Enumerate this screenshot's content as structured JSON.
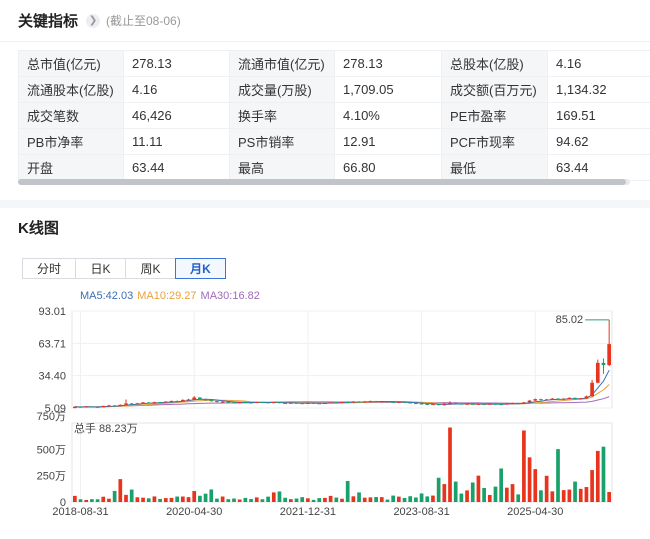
{
  "key_metrics": {
    "title": "关键指标",
    "date_note": "(截止至08-06)",
    "rows": [
      [
        {
          "label": "总市值(亿元)",
          "value": "278.13"
        },
        {
          "label": "流通市值(亿元)",
          "value": "278.13"
        },
        {
          "label": "总股本(亿股)",
          "value": "4.16"
        }
      ],
      [
        {
          "label": "流通股本(亿股)",
          "value": "4.16"
        },
        {
          "label": "成交量(万股)",
          "value": "1,709.05"
        },
        {
          "label": "成交额(百万元)",
          "value": "1,134.32"
        }
      ],
      [
        {
          "label": "成交笔数",
          "value": "46,426"
        },
        {
          "label": "换手率",
          "value": "4.10%"
        },
        {
          "label": "PE市盈率",
          "value": "169.51"
        }
      ],
      [
        {
          "label": "PB市净率",
          "value": "11.11"
        },
        {
          "label": "PS市销率",
          "value": "12.91"
        },
        {
          "label": "PCF市现率",
          "value": "94.62"
        }
      ],
      [
        {
          "label": "开盘",
          "value": "63.44"
        },
        {
          "label": "最高",
          "value": "66.80"
        },
        {
          "label": "最低",
          "value": "63.44"
        }
      ]
    ]
  },
  "kline": {
    "title": "K线图",
    "tabs": [
      "分时",
      "日K",
      "周K",
      "月K"
    ],
    "active_tab": 3,
    "ma": {
      "ma5": "MA5:42.03",
      "ma10": "MA10:29.27",
      "ma30": "MA30:16.82"
    },
    "colors": {
      "up": "#e8341c",
      "down": "#1aa06a",
      "ma5": "#3d6fb6",
      "ma10": "#e8a23b",
      "ma30": "#a06bb8"
    }
  },
  "chart_data": {
    "type": "candlestick",
    "price_ticks": [
      "93.01",
      "63.71",
      "34.40",
      "5.09"
    ],
    "price_range": [
      5.09,
      93.01
    ],
    "max_marker": "85.02",
    "volume_header": "750万",
    "volume_ticks": [
      "500万",
      "250万",
      "0"
    ],
    "volume_unit_max": 750,
    "volume_label": "总手 88.23万",
    "x_labels": [
      "2018-08-31",
      "2020-04-30",
      "2021-12-31",
      "2023-08-31",
      "2025-04-30"
    ],
    "x_label_index": [
      1,
      21,
      41,
      61,
      81
    ],
    "candles": [
      [
        5.0,
        6.2,
        4.9,
        6.5,
        0
      ],
      [
        6.2,
        5.8,
        5.5,
        6.6,
        1
      ],
      [
        5.8,
        6.4,
        5.6,
        6.7,
        0
      ],
      [
        6.4,
        6.1,
        5.9,
        6.6,
        1
      ],
      [
        6.1,
        5.9,
        5.6,
        6.4,
        1
      ],
      [
        5.9,
        7.0,
        5.8,
        7.2,
        0
      ],
      [
        7.0,
        7.4,
        6.8,
        8.0,
        0
      ],
      [
        7.4,
        7.2,
        6.9,
        7.8,
        1
      ],
      [
        7.2,
        8.0,
        7.0,
        8.3,
        0
      ],
      [
        8.0,
        9.2,
        7.8,
        12.8,
        0
      ],
      [
        9.2,
        8.6,
        8.3,
        9.5,
        1
      ],
      [
        8.6,
        9.4,
        8.5,
        9.8,
        0
      ],
      [
        9.4,
        10.1,
        9.2,
        10.5,
        0
      ],
      [
        10.1,
        9.6,
        9.3,
        10.4,
        1
      ],
      [
        9.6,
        10.4,
        9.5,
        10.8,
        0
      ],
      [
        10.4,
        10.0,
        9.7,
        10.7,
        1
      ],
      [
        10.0,
        10.9,
        9.8,
        11.2,
        0
      ],
      [
        10.9,
        11.5,
        10.7,
        11.8,
        0
      ],
      [
        11.5,
        11.2,
        10.9,
        11.9,
        1
      ],
      [
        11.2,
        12.4,
        11.0,
        13.0,
        0
      ],
      [
        12.4,
        12.8,
        12.1,
        13.4,
        0
      ],
      [
        12.8,
        14.6,
        12.5,
        15.8,
        0
      ],
      [
        14.6,
        13.2,
        12.8,
        14.9,
        1
      ],
      [
        13.2,
        12.1,
        11.7,
        13.5,
        1
      ],
      [
        12.1,
        11.4,
        11.0,
        12.3,
        1
      ],
      [
        11.4,
        10.6,
        10.2,
        11.6,
        1
      ],
      [
        10.6,
        10.9,
        10.3,
        11.2,
        0
      ],
      [
        10.9,
        10.2,
        9.9,
        11.1,
        1
      ],
      [
        10.2,
        9.8,
        9.5,
        10.4,
        1
      ],
      [
        9.8,
        10.4,
        9.6,
        10.7,
        0
      ],
      [
        10.4,
        10.1,
        9.8,
        10.6,
        1
      ],
      [
        10.1,
        9.7,
        9.4,
        10.3,
        1
      ],
      [
        9.7,
        10.5,
        9.6,
        10.8,
        0
      ],
      [
        10.5,
        10.2,
        9.9,
        10.8,
        1
      ],
      [
        10.2,
        9.9,
        9.6,
        10.4,
        1
      ],
      [
        9.9,
        10.4,
        9.7,
        10.7,
        0
      ],
      [
        10.4,
        9.6,
        9.3,
        10.6,
        1
      ],
      [
        9.6,
        9.2,
        8.9,
        9.8,
        1
      ],
      [
        9.2,
        9.8,
        9.0,
        10.0,
        0
      ],
      [
        9.8,
        9.5,
        9.2,
        10.0,
        1
      ],
      [
        9.5,
        9.3,
        9.0,
        9.8,
        1
      ],
      [
        9.3,
        9.7,
        9.1,
        10.2,
        0
      ],
      [
        9.7,
        9.4,
        9.1,
        9.9,
        1
      ],
      [
        9.4,
        9.1,
        8.8,
        9.6,
        1
      ],
      [
        9.1,
        9.6,
        8.9,
        9.8,
        0
      ],
      [
        9.6,
        10.1,
        9.4,
        10.4,
        0
      ],
      [
        10.1,
        9.8,
        9.5,
        10.3,
        1
      ],
      [
        9.8,
        10.5,
        9.6,
        10.8,
        0
      ],
      [
        10.5,
        10.2,
        9.9,
        11.2,
        1
      ],
      [
        10.2,
        11.0,
        10.0,
        11.4,
        0
      ],
      [
        11.0,
        10.5,
        10.2,
        11.3,
        1
      ],
      [
        10.5,
        10.9,
        10.3,
        11.5,
        0
      ],
      [
        10.9,
        11.3,
        10.6,
        11.8,
        0
      ],
      [
        11.3,
        10.8,
        10.5,
        11.6,
        1
      ],
      [
        10.8,
        11.2,
        10.5,
        11.5,
        0
      ],
      [
        11.2,
        10.7,
        10.4,
        11.4,
        1
      ],
      [
        10.7,
        10.3,
        10.0,
        10.9,
        1
      ],
      [
        10.3,
        10.6,
        10.0,
        10.9,
        0
      ],
      [
        10.6,
        10.1,
        9.8,
        10.8,
        1
      ],
      [
        10.1,
        9.6,
        9.2,
        10.3,
        1
      ],
      [
        9.6,
        9.2,
        8.6,
        9.8,
        1
      ],
      [
        9.2,
        8.8,
        8.3,
        9.4,
        1
      ],
      [
        8.8,
        8.2,
        7.6,
        9.0,
        1
      ],
      [
        8.2,
        8.6,
        8.0,
        8.9,
        0
      ],
      [
        8.6,
        7.9,
        7.4,
        8.8,
        1
      ],
      [
        7.9,
        8.4,
        7.6,
        10.2,
        0
      ],
      [
        8.4,
        9.6,
        8.1,
        11.2,
        0
      ],
      [
        9.6,
        9.0,
        8.7,
        9.9,
        1
      ],
      [
        9.0,
        8.6,
        8.3,
        9.3,
        1
      ],
      [
        8.6,
        8.9,
        8.4,
        9.2,
        0
      ],
      [
        8.9,
        8.5,
        8.2,
        9.1,
        1
      ],
      [
        8.5,
        8.8,
        8.3,
        9.1,
        0
      ],
      [
        8.8,
        8.4,
        8.1,
        9.0,
        1
      ],
      [
        8.4,
        8.9,
        8.2,
        9.2,
        0
      ],
      [
        8.9,
        8.6,
        8.3,
        9.1,
        1
      ],
      [
        8.6,
        8.3,
        8.0,
        8.8,
        1
      ],
      [
        8.3,
        9.1,
        8.1,
        9.4,
        0
      ],
      [
        9.1,
        9.5,
        8.9,
        9.9,
        0
      ],
      [
        9.5,
        9.0,
        8.7,
        9.8,
        1
      ],
      [
        9.0,
        10.2,
        8.9,
        10.6,
        0
      ],
      [
        10.2,
        11.8,
        10.0,
        12.4,
        0
      ],
      [
        11.8,
        13.1,
        11.5,
        13.6,
        0
      ],
      [
        13.1,
        12.2,
        11.8,
        13.5,
        1
      ],
      [
        12.2,
        12.9,
        11.9,
        13.3,
        0
      ],
      [
        12.9,
        13.6,
        12.6,
        14.1,
        0
      ],
      [
        13.6,
        12.8,
        12.5,
        14.0,
        1
      ],
      [
        12.8,
        13.5,
        12.6,
        13.9,
        0
      ],
      [
        13.5,
        14.3,
        13.2,
        14.8,
        0
      ],
      [
        14.3,
        13.2,
        12.9,
        14.6,
        1
      ],
      [
        13.2,
        13.8,
        13.0,
        14.2,
        0
      ],
      [
        13.8,
        15.6,
        13.5,
        16.4,
        0
      ],
      [
        15.6,
        28.0,
        15.3,
        30.5,
        0
      ],
      [
        28.0,
        46.0,
        27.5,
        49.0,
        0
      ],
      [
        46.0,
        44.0,
        36.0,
        50.0,
        1
      ],
      [
        44.0,
        63.0,
        43.0,
        85.02,
        0
      ]
    ],
    "volumes": [
      58,
      26,
      19,
      27,
      26,
      50,
      31,
      105,
      217,
      68,
      118,
      45,
      41,
      35,
      53,
      29,
      37,
      39,
      52,
      52,
      46,
      104,
      59,
      79,
      119,
      32,
      52,
      27,
      33,
      24,
      39,
      28,
      44,
      26,
      51,
      91,
      100,
      40,
      27,
      33,
      46,
      35,
      20,
      37,
      39,
      58,
      42,
      31,
      199,
      54,
      91,
      41,
      44,
      47,
      46,
      23,
      61,
      51,
      38,
      55,
      43,
      81,
      53,
      61,
      230,
      170,
      707,
      194,
      80,
      110,
      185,
      250,
      133,
      67,
      146,
      318,
      136,
      170,
      72,
      679,
      424,
      312,
      111,
      249,
      101,
      502,
      113,
      118,
      194,
      125,
      142,
      303,
      485,
      525,
      95
    ]
  }
}
